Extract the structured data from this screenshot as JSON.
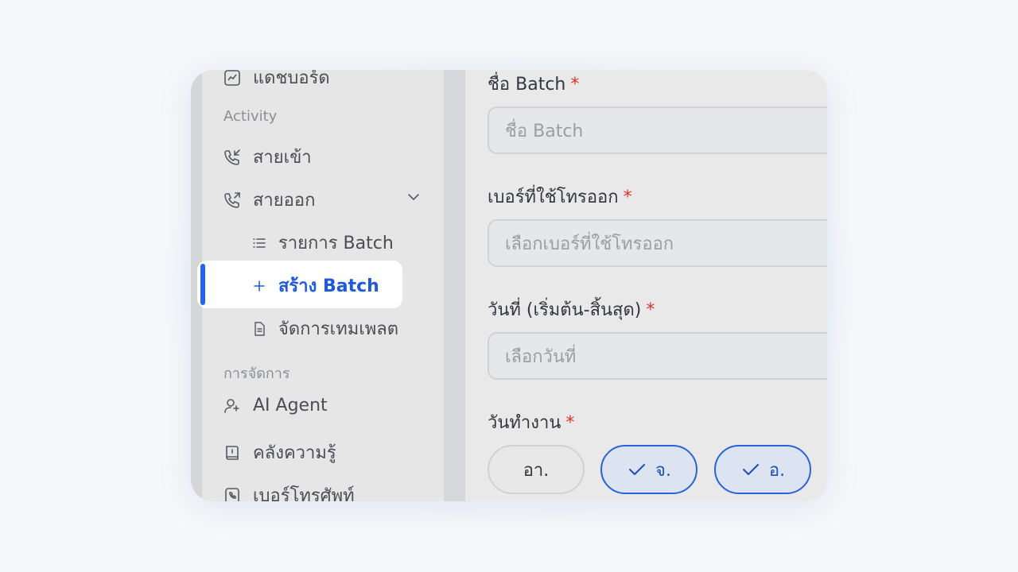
{
  "sidebar": {
    "dashboard_label": "แดชบอร์ด",
    "section_activity": "Activity",
    "incoming_label": "สายเข้า",
    "outgoing_label": "สายออก",
    "sub_items": {
      "batch_list": "รายการ Batch",
      "create_batch": "สร้าง Batch",
      "manage_templates": "จัดการเทมเพลต"
    },
    "section_management": "การจัดการ",
    "ai_agent_label": "AI Agent",
    "knowledge_label": "คลังความรู้",
    "phone_numbers_label": "เบอร์โทรศัพท์"
  },
  "form": {
    "batch_name_label": "ชื่อ Batch",
    "batch_name_placeholder": "ชื่อ Batch",
    "outbound_number_label": "เบอร์ที่ใช้โทรออก",
    "outbound_number_placeholder": "เลือกเบอร์ที่ใช้โทรออก",
    "date_range_label": "วันที่ (เริ่มต้น-สิ้นสุด)",
    "date_range_placeholder": "เลือกวันที่",
    "workdays_label": "วันทำงาน",
    "required_mark": "*",
    "days": [
      {
        "label": "อา.",
        "selected": false
      },
      {
        "label": "จ.",
        "selected": true
      },
      {
        "label": "อ.",
        "selected": true
      }
    ]
  },
  "colors": {
    "accent": "#2563eb",
    "required": "#e03131"
  }
}
